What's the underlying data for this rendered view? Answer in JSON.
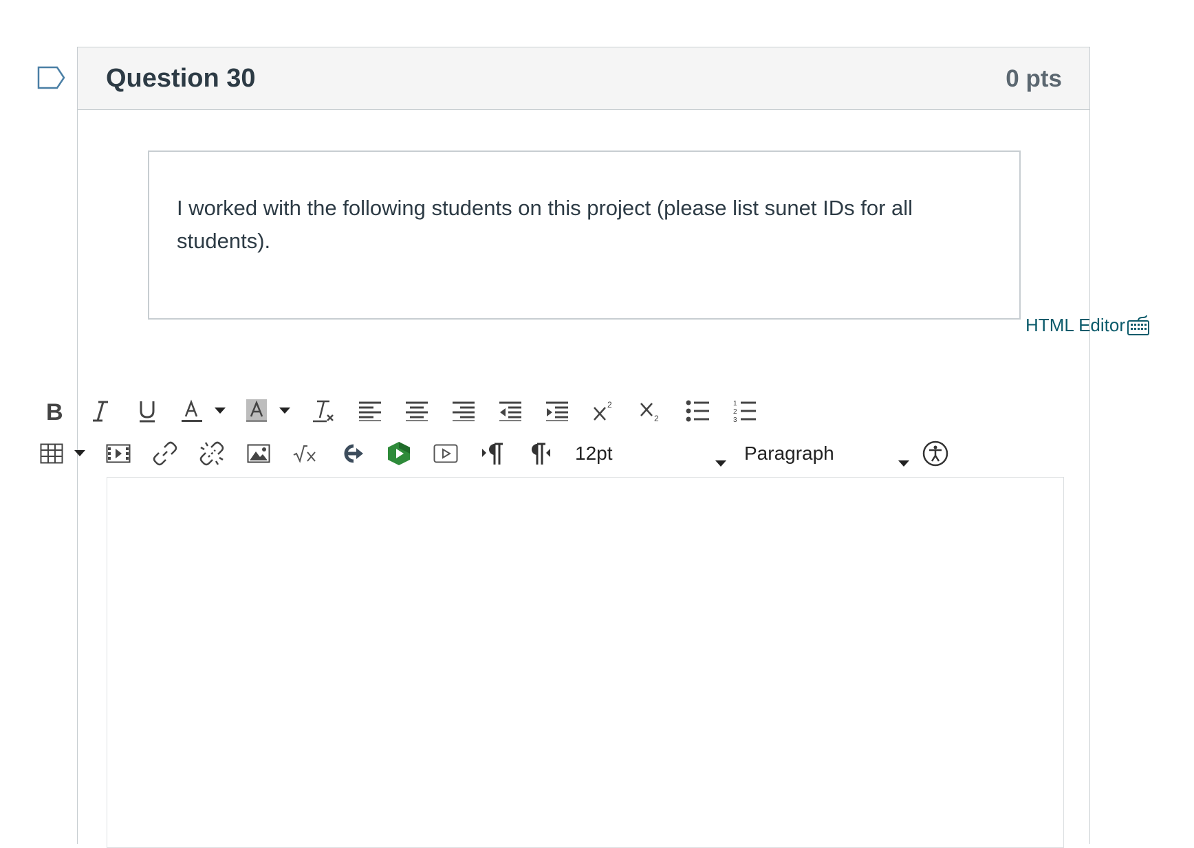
{
  "question": {
    "title": "Question 30",
    "points": "0 pts",
    "text": "I worked with the following students on this project (please list sunet IDs for all students)."
  },
  "editor": {
    "html_editor_label": "HTML Editor",
    "font_size": "12pt",
    "block_format": "Paragraph",
    "content": ""
  },
  "toolbar": {
    "row1": [
      "bold-icon",
      "italic-icon",
      "underline-icon",
      "text-color-icon",
      "background-color-icon",
      "clear-formatting-icon",
      "align-left-icon",
      "align-center-icon",
      "align-right-icon",
      "outdent-icon",
      "indent-icon",
      "superscript-icon",
      "subscript-icon",
      "bullet-list-icon",
      "numbered-list-icon"
    ],
    "row2": [
      "table-icon",
      "media-icon",
      "link-icon",
      "unlink-icon",
      "image-icon",
      "equation-icon",
      "lti-tool-icon",
      "google-drive-icon",
      "video-embed-icon",
      "ltr-icon",
      "rtl-icon",
      "accessibility-checker-icon"
    ]
  },
  "colors": {
    "header_bg": "#f5f5f5",
    "text": "#2d3b45",
    "link": "#0b5b6b",
    "border": "#c7cdd1"
  }
}
